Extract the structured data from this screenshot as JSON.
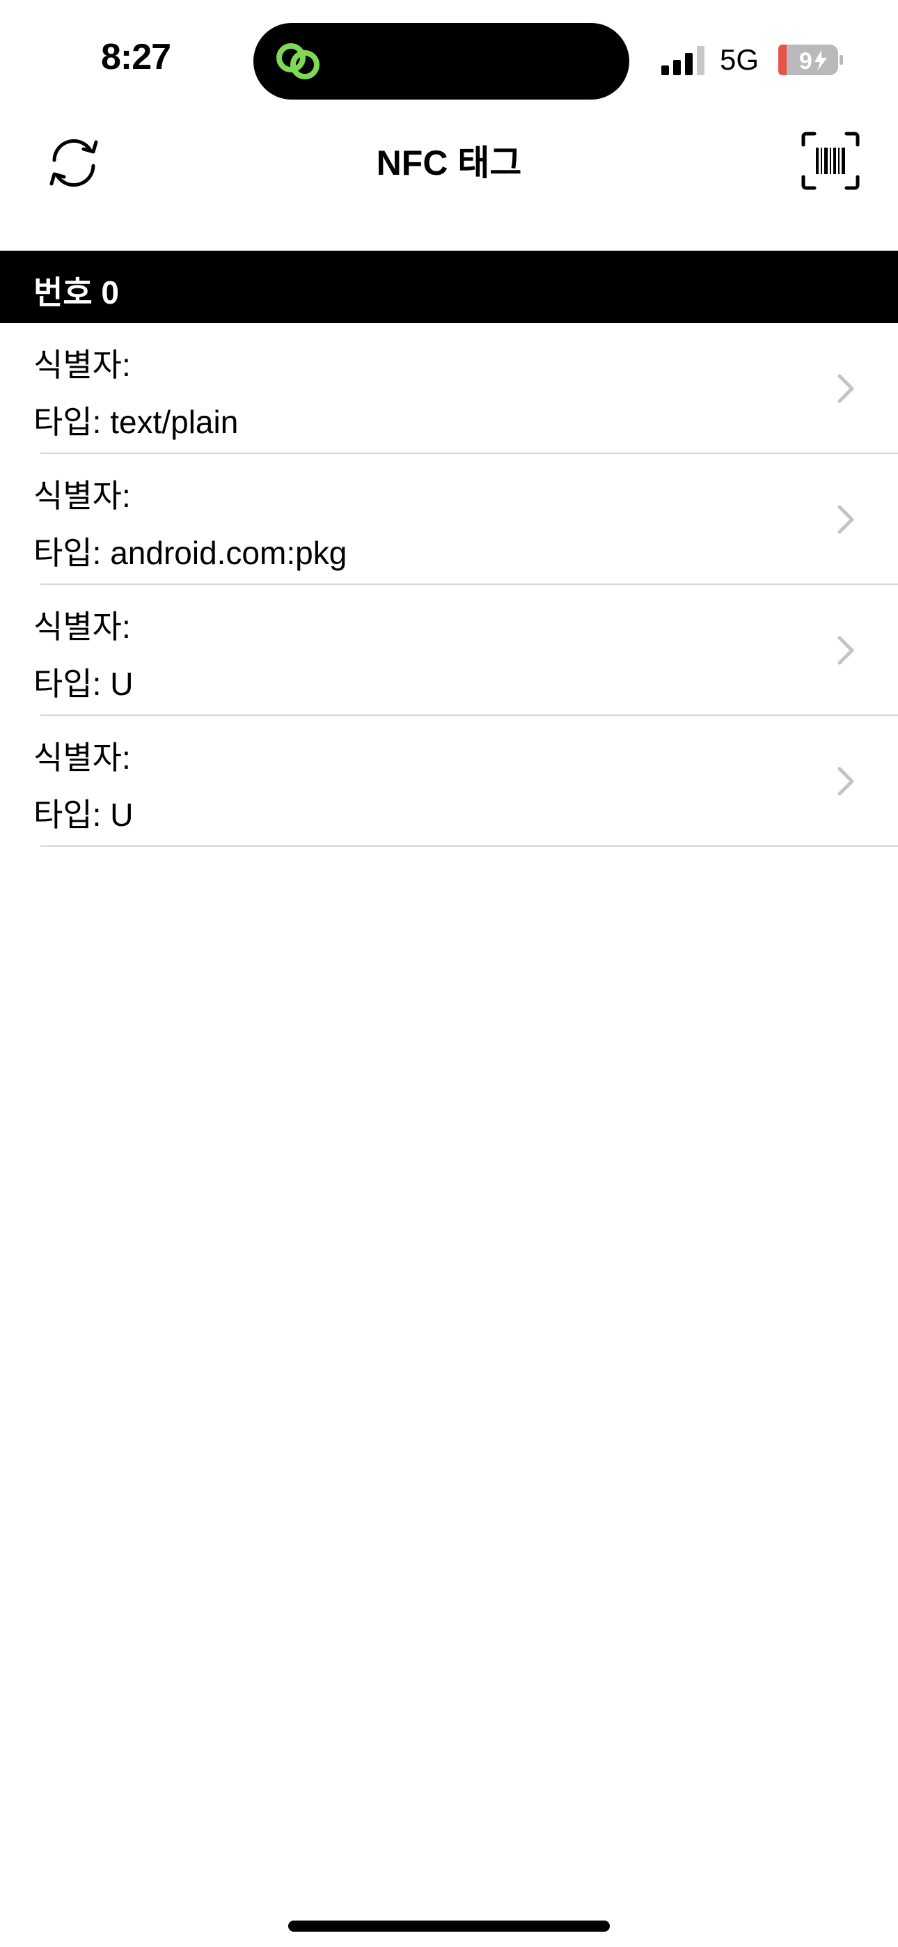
{
  "status_bar": {
    "time": "8:27",
    "network": "5G",
    "battery_level": "9",
    "icons": [
      "link-icon",
      "signal-icon",
      "battery-charging-icon"
    ],
    "link_color": "#7ed957"
  },
  "nav": {
    "title": "NFC 태그",
    "left_icon": "refresh-icon",
    "right_icon": "barcode-scan-icon"
  },
  "section": {
    "title": "번호 0"
  },
  "records": [
    {
      "identifier": "식별자:",
      "type": "타입: text/plain"
    },
    {
      "identifier": "식별자:",
      "type": "타입: android.com:pkg"
    },
    {
      "identifier": "식별자:",
      "type": "타입: U"
    },
    {
      "identifier": "식별자:",
      "type": "타입: U"
    }
  ],
  "colors": {
    "header_bg": "#000000",
    "header_text": "#ffffff",
    "separator": "#d6d6d8",
    "chevron": "#c4c4c7",
    "battery_low": "#e5534b"
  }
}
